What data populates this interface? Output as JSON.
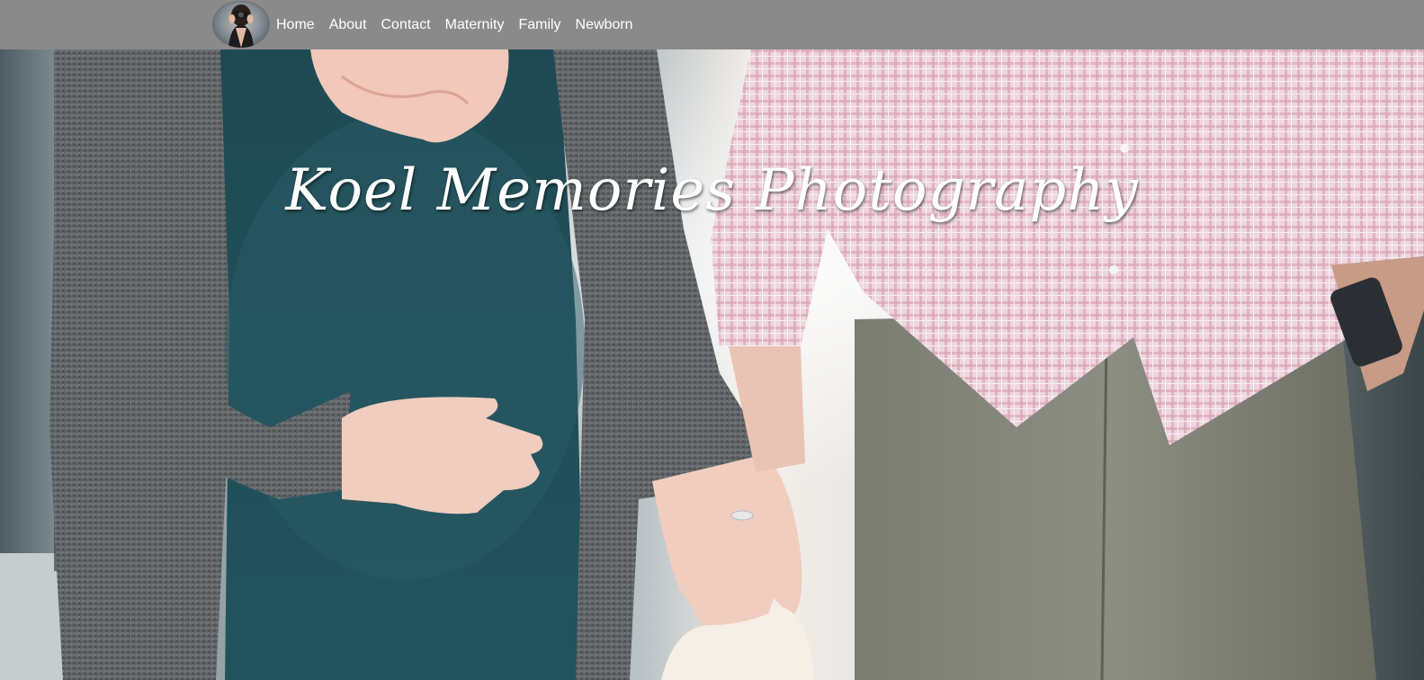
{
  "nav": {
    "logo_alt": "photographer-logo",
    "links": [
      {
        "label": "Home"
      },
      {
        "label": "About"
      },
      {
        "label": "Contact"
      },
      {
        "label": "Maternity"
      },
      {
        "label": "Family"
      },
      {
        "label": "Newborn"
      }
    ]
  },
  "hero": {
    "title": "Koel Memories Photography"
  },
  "colors": {
    "navbar_bg": "#8a8a8a",
    "nav_text": "#ffffff",
    "title_text": "#ffffff"
  }
}
